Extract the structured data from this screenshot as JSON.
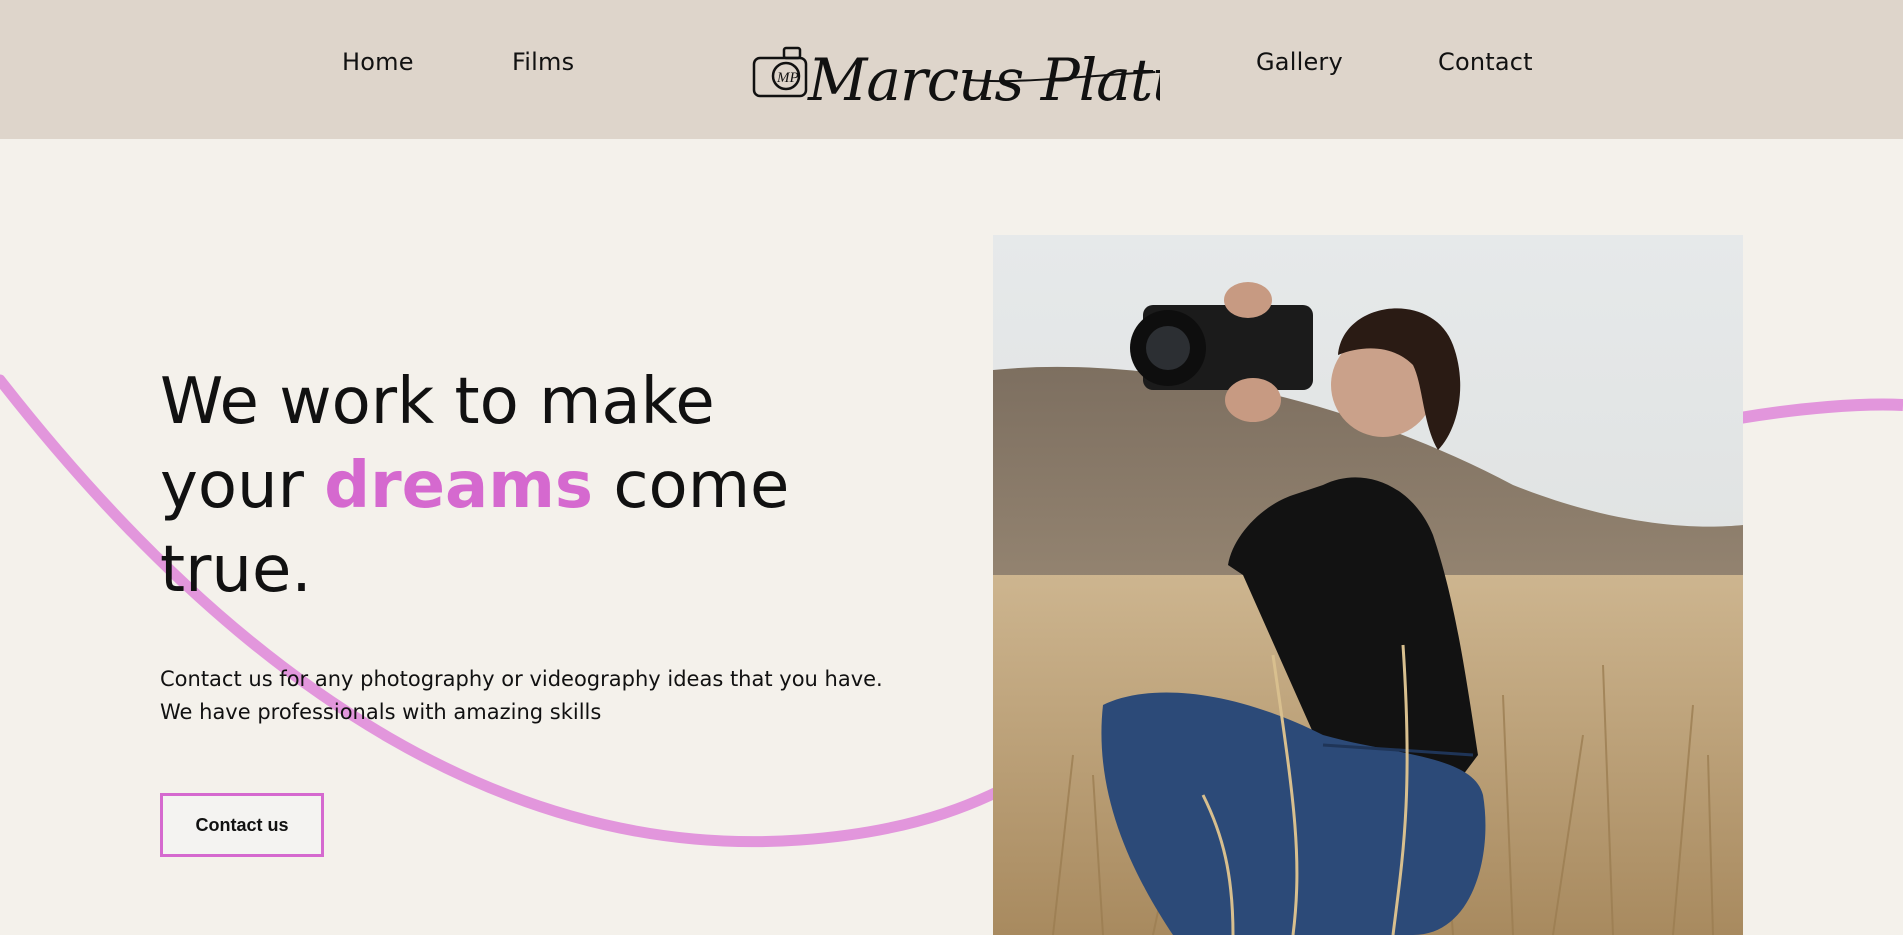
{
  "nav": {
    "left": [
      "Home",
      "Films"
    ],
    "right": [
      "Gallery",
      "Contact"
    ]
  },
  "logo": {
    "text": "Marcus Platt",
    "initials": "MP"
  },
  "hero": {
    "title_before": "We work to make your ",
    "title_accent": "dreams",
    "title_after": " come true.",
    "subtitle_line1": "Contact us for any photography or videography ideas that you have.",
    "subtitle_line2": "We have professionals with amazing skills",
    "cta_label": "Contact us"
  },
  "colors": {
    "header_bg": "#ded5cb",
    "page_bg": "#f4f1eb",
    "accent": "#d569cf",
    "curve": "#e296dc"
  },
  "icons": [
    "camera-icon"
  ]
}
